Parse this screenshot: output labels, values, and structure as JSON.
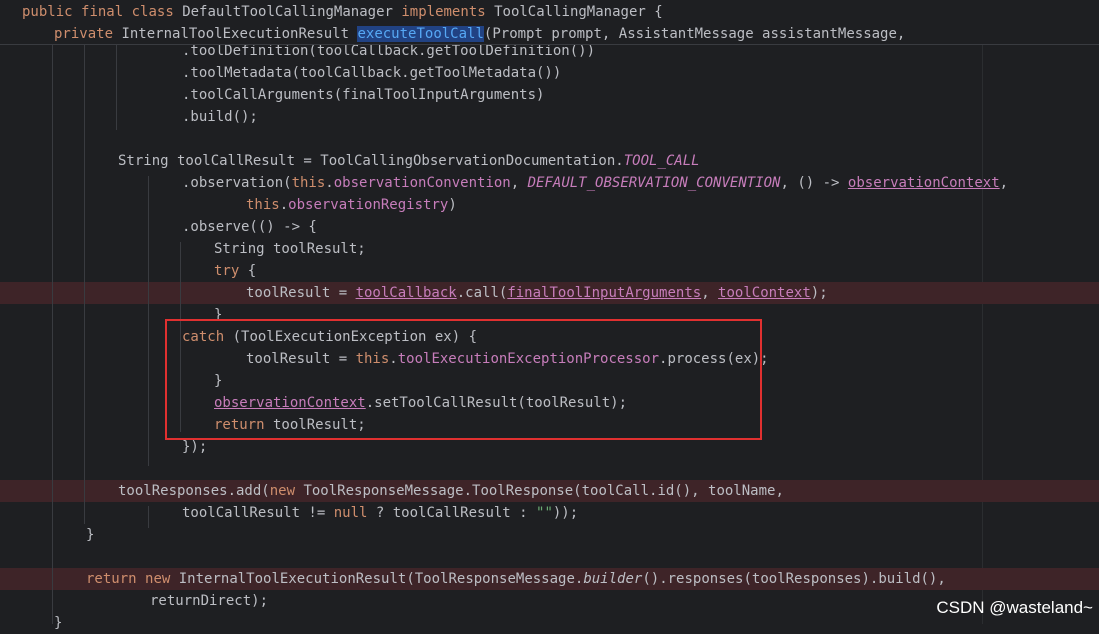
{
  "sticky": {
    "line1": [
      "public",
      "final",
      "class",
      "DefaultToolCallingManager",
      "implements",
      "ToolCallingManager {"
    ],
    "line2": [
      "private",
      "InternalToolExecutionResult",
      "executeToolCall",
      "(Prompt prompt, AssistantMessage assistantMessage,"
    ]
  },
  "code": {
    "l1": ".toolDefinition(toolCallback.getToolDefinition())",
    "l2": ".toolMetadata(toolCallback.getToolMetadata())",
    "l3": ".toolCallArguments(finalToolInputArguments)",
    "l4": ".build();",
    "l5a": "String toolCallResult = ToolCallingObservationDocumentation.",
    "l5b": "TOOL_CALL",
    "l6a": ".observation(",
    "l6b": "this",
    "l6c": ".",
    "l6d": "observationConvention",
    "l6e": ", ",
    "l6f": "DEFAULT_OBSERVATION_CONVENTION",
    "l6g": ", () -> ",
    "l6h": "observationContext",
    "l6i": ",",
    "l7a": "this",
    "l7b": ".",
    "l7c": "observationRegistry",
    "l7d": ")",
    "l8": ".observe(() -> {",
    "l9": "String toolResult;",
    "l10a": "try",
    "l10b": " {",
    "l11a": "toolResult = ",
    "l11b": "toolCallback",
    "l11c": ".call(",
    "l11d": "finalToolInputArguments",
    "l11e": ", ",
    "l11f": "toolContext",
    "l11g": ");",
    "l12": "}",
    "l13a": "catch",
    "l13b": " (ToolExecutionException ex) {",
    "l14a": "toolResult = ",
    "l14b": "this",
    "l14c": ".",
    "l14d": "toolExecutionExceptionProcessor",
    "l14e": ".process(ex);",
    "l15": "}",
    "l16a": "observationContext",
    "l16b": ".setToolCallResult(toolResult);",
    "l17a": "return",
    "l17b": " toolResult;",
    "l18": "});",
    "l19a": "toolResponses.add(",
    "l19b": "new",
    "l19c": " ToolResponseMessage.ToolResponse(toolCall.id(), toolName,",
    "l20a": "toolCallResult != ",
    "l20b": "null",
    "l20c": " ? toolCallResult : ",
    "l20d": "\"\"",
    "l20e": "));",
    "l21": "}",
    "l22a": "return",
    "l22b": " ",
    "l22c": "new",
    "l22d": " InternalToolExecutionResult(ToolResponseMessage.",
    "l22e": "builder",
    "l22f": "().responses(toolResponses).build(),",
    "l23": "returnDirect);",
    "l24": "}"
  },
  "watermark": "CSDN @wasteland~"
}
